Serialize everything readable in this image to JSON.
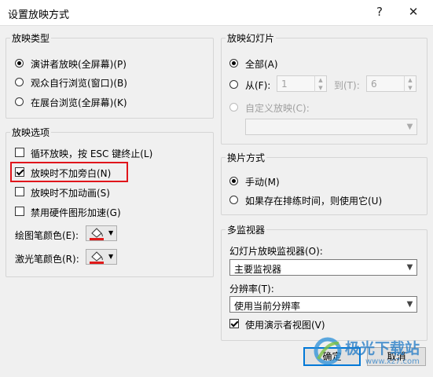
{
  "window": {
    "title": "设置放映方式",
    "help_icon": "?",
    "close_icon": "✕"
  },
  "show_type": {
    "title": "放映类型",
    "options": [
      "演讲者放映(全屏幕)(P)",
      "观众自行浏览(窗口)(B)",
      "在展台浏览(全屏幕)(K)"
    ]
  },
  "show_options": {
    "title": "放映选项",
    "items": [
      "循环放映，按 ESC 键终止(L)",
      "放映时不加旁白(N)",
      "放映时不加动画(S)",
      "禁用硬件图形加速(G)"
    ],
    "pen_color_label": "绘图笔颜色(E):",
    "laser_color_label": "激光笔颜色(R):",
    "pen_color": "#e11b1b",
    "laser_color": "#e11b1b"
  },
  "slides": {
    "title": "放映幻灯片",
    "all_label": "全部(A)",
    "from_label": "从(F):",
    "from_value": "1",
    "to_label": "到(T):",
    "to_value": "6",
    "custom_label": "自定义放映(C):"
  },
  "advance": {
    "title": "换片方式",
    "options": [
      "手动(M)",
      "如果存在排练时间，则使用它(U)"
    ]
  },
  "monitors": {
    "title": "多监视器",
    "monitor_label": "幻灯片放映监视器(O):",
    "monitor_value": "主要监视器",
    "resolution_label": "分辨率(T):",
    "resolution_value": "使用当前分辨率",
    "presenter_view_label": "使用演示者视图(V)"
  },
  "buttons": {
    "ok": "确定",
    "cancel": "取消"
  },
  "watermark": {
    "name": "极光下载站",
    "url": "www.xz7.com"
  },
  "colors": {
    "accent": "#0078d7",
    "highlight": "#e0151b"
  }
}
